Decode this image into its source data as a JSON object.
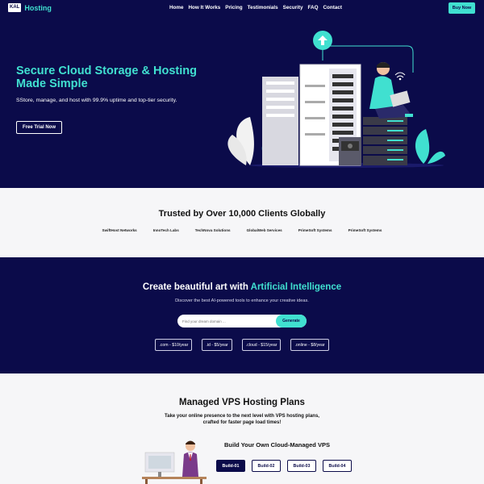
{
  "nav": {
    "logo_box": "KAL",
    "logo_text": "Hosting",
    "items": [
      "Home",
      "How It Works",
      "Pricing",
      "Testimonials",
      "Security",
      "FAQ",
      "Contact"
    ],
    "cta": "Buy Now"
  },
  "hero": {
    "title": "Secure Cloud Storage & Hosting Made Simple",
    "subtitle": "SStore, manage, and host with 99.9% uptime and top-tier security.",
    "cta": "Free Trial Now"
  },
  "trusted": {
    "title": "Trusted by Over 10,000 Clients Globally",
    "clients": [
      "SwiftHost Networks",
      "InnoTech Labs",
      "TechNova Solutions",
      "GlobalWeb Services",
      "PrimeSoft Systems",
      "PrimeSoft Systems"
    ]
  },
  "ai": {
    "title_prefix": "Create beautiful art with ",
    "title_accent": "Artificial Intelligence",
    "subtitle": "Discover the best AI-powered tools to enhance your creative ideas.",
    "search_placeholder": "Find your dream domain ...",
    "generate_label": "Generate",
    "domains": [
      ".com - $10/year",
      ".id - $5/year",
      ".cloud - $15/year",
      ".online - $8/year"
    ]
  },
  "vps": {
    "title": "Managed VPS Hosting Plans",
    "subtitle": "Take your online presence to the next level with VPS hosting plans, crafted for faster page load times!",
    "build_title": "Build Your Own Cloud-Managed VPS",
    "builds": [
      "Build-01",
      "Build-02",
      "Build-03",
      "Build-04"
    ],
    "active_build": "Build-01"
  },
  "colors": {
    "navy": "#0b0b4a",
    "accent": "#40e0d0",
    "light_bg": "#f6f6f8"
  }
}
